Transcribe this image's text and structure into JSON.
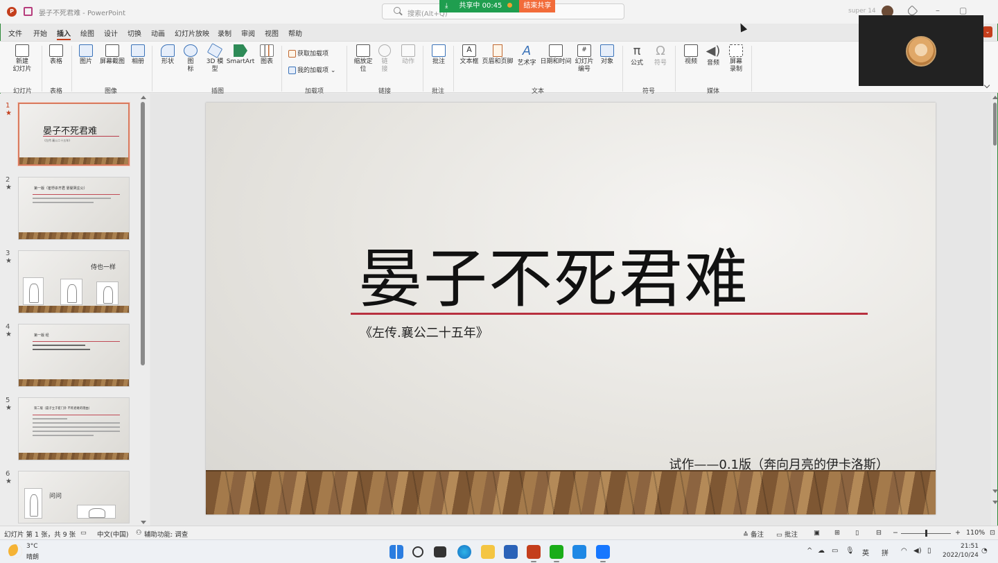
{
  "app": {
    "doc_title": "晏子不死君难",
    "app_name": "PowerPoint"
  },
  "titlebar": {
    "search_placeholder": "搜索(Alt+Q)",
    "sharing_status": "共享中 00:45",
    "end_share": "结束共享",
    "user": "super 14"
  },
  "menu": [
    "文件",
    "开始",
    "插入",
    "绘图",
    "设计",
    "切换",
    "动画",
    "幻灯片放映",
    "录制",
    "审阅",
    "视图",
    "帮助"
  ],
  "menu_active": "插入",
  "ribbon": {
    "new_slide": "新建\n幻灯片",
    "table": "表格",
    "picture": "图片",
    "screenshot": "屏幕截图",
    "album": "相册",
    "shapes": "形状",
    "icons": "图\n标",
    "model3d": "3D 模\n型",
    "smartart": "SmartArt",
    "chart": "图表",
    "get_addins": "获取加载项",
    "my_addins": "我的加载项",
    "zoom": "缩放定\n位",
    "link": "链\n接",
    "action": "动作",
    "comment": "批注",
    "textbox": "文本框",
    "header_footer": "页眉和页脚",
    "wordart": "艺术字",
    "datetime": "日期和时间",
    "slide_number": "幻灯片\n编号",
    "object": "对象",
    "equation": "公式",
    "symbol": "符号",
    "video": "视频",
    "audio": "音频",
    "screen_record": "屏幕\n录制",
    "groups": {
      "slides": "幻灯片",
      "tables": "表格",
      "images": "图像",
      "illustrations": "插图",
      "addins": "加载项",
      "links": "链接",
      "comments": "批注",
      "text": "文本",
      "symbols": "符号",
      "media": "媒体"
    }
  },
  "thumbnails": [
    {
      "num": "1",
      "title": "晏子不死君难",
      "subtitle": "《左传.襄公二十五年》"
    },
    {
      "num": "2",
      "heading": "第一版（崔杼杀齐君 晏婴哭庄公）"
    },
    {
      "num": "3",
      "text": "侍也一样"
    },
    {
      "num": "4",
      "heading": "第一版  经"
    },
    {
      "num": "5",
      "heading": "第二版（晏子立于崔门外 不死君难的理由）"
    },
    {
      "num": "6",
      "text": "问问"
    }
  ],
  "slide": {
    "title": "晏子不死君难",
    "subtitle": "《左传.襄公二十五年》",
    "version": "试作——0.1版（奔向月亮的伊卡洛斯）"
  },
  "statusbar": {
    "slide_info": "幻灯片 第 1 张，共 9 张",
    "language": "中文(中国)",
    "accessibility": "辅助功能: 调查",
    "notes": "备注",
    "comments": "批注",
    "zoom": "110%"
  },
  "taskbar": {
    "weather_temp": "3°C",
    "weather_desc": "晴朗",
    "ime1": "英",
    "ime2": "拼",
    "time": "21:51",
    "date": "2022/10/24"
  }
}
